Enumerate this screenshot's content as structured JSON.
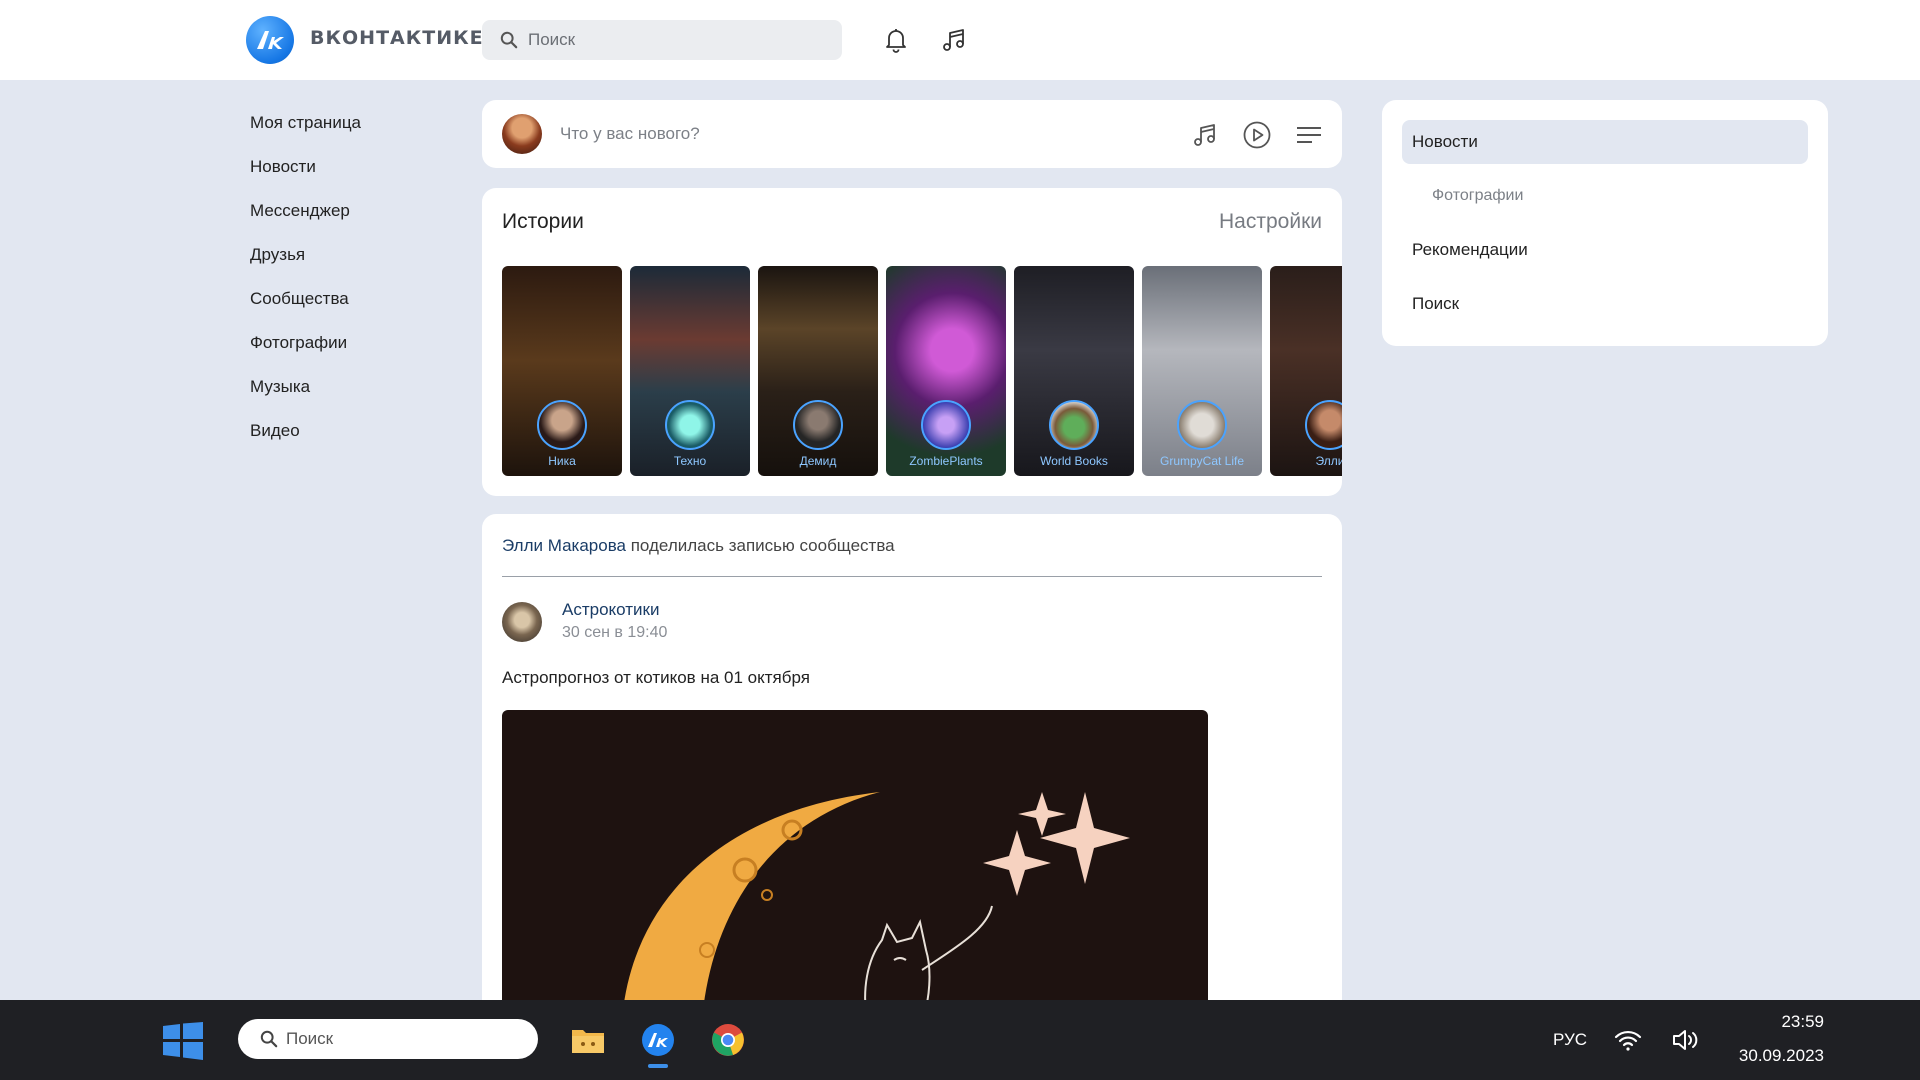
{
  "app": {
    "name": "ВКОНТАКТИКЕ",
    "logo_glyph": "ʌк"
  },
  "header": {
    "search_placeholder": "Поиск",
    "icons": [
      "bell-icon",
      "music-icon"
    ]
  },
  "left_nav": [
    {
      "label": "Моя страница"
    },
    {
      "label": "Новости"
    },
    {
      "label": "Мессенджер"
    },
    {
      "label": "Друзья"
    },
    {
      "label": "Сообщества"
    },
    {
      "label": "Фотографии"
    },
    {
      "label": "Музыка"
    },
    {
      "label": "Видео"
    }
  ],
  "composer": {
    "placeholder": "Что у вас нового?",
    "icons": [
      "music-icon",
      "play-icon",
      "menu-icon"
    ]
  },
  "stories": {
    "title": "Истории",
    "settings_label": "Настройки",
    "items": [
      {
        "name": "Ника"
      },
      {
        "name": "Техно"
      },
      {
        "name": "Демид"
      },
      {
        "name": "ZombiePlants"
      },
      {
        "name": "World Books"
      },
      {
        "name": "GrumpyCat Life"
      },
      {
        "name": "Элли"
      }
    ]
  },
  "post": {
    "author": "Элли Макарова",
    "action": " поделилась записью сообщества",
    "group": "Астрокотики",
    "date": "30 сен в 19:40",
    "text": "Астропрогноз от котиков на 01 октября"
  },
  "right_nav": [
    {
      "label": "Новости",
      "active": true
    },
    {
      "label": "Фотографии",
      "sub": true
    },
    {
      "label": "Рекомендации"
    },
    {
      "label": "Поиск"
    }
  ],
  "taskbar": {
    "search_placeholder": "Поиск",
    "lang": "РУС",
    "time": "23:59",
    "date": "30.09.2023"
  },
  "colors": {
    "accent": "#1677e5",
    "page_bg": "#e2e7f1",
    "link": "#1a3c66",
    "taskbar_bg": "#1f2024"
  }
}
